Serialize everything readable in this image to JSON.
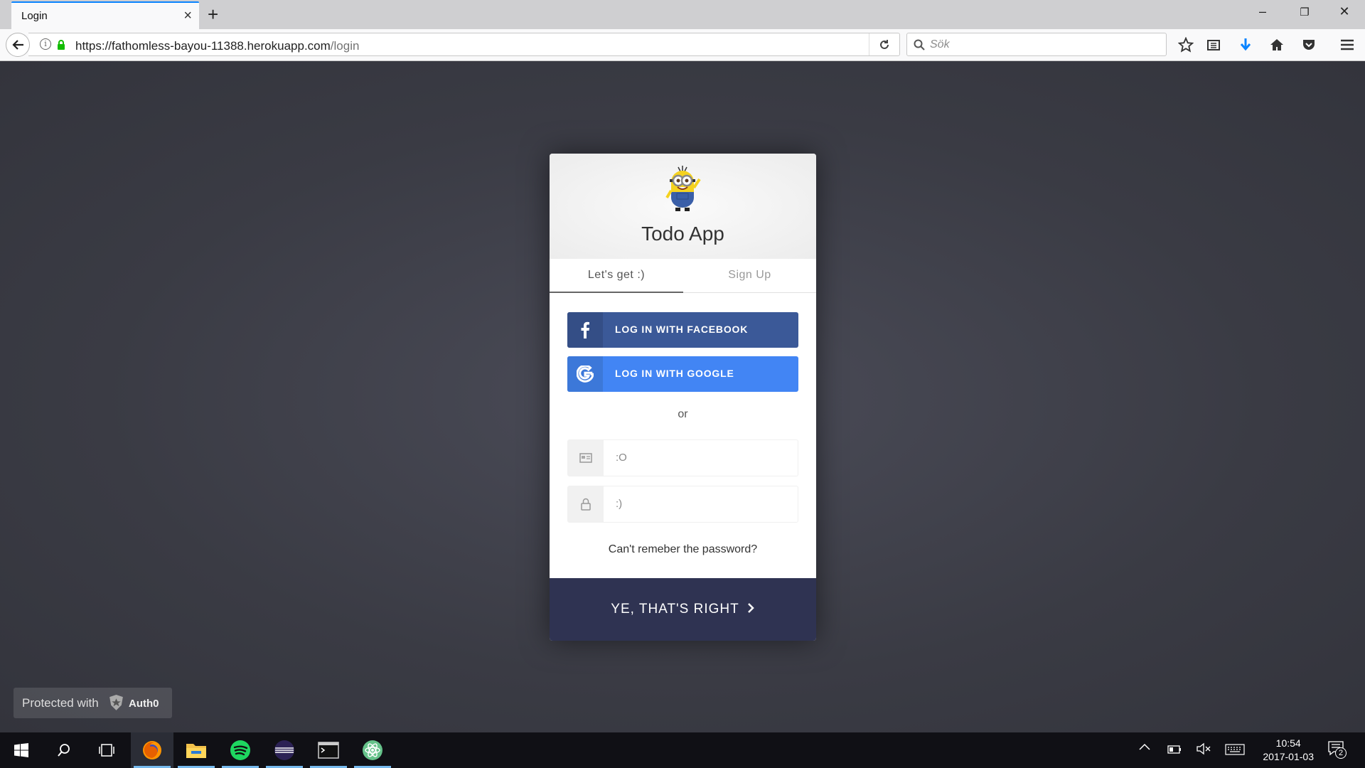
{
  "browser": {
    "tab_title": "Login",
    "url_host": "https://fathomless-bayou-11388.herokuapp.com",
    "url_path": "/login",
    "search_placeholder": "Sök"
  },
  "login": {
    "app_name": "Todo App",
    "tabs": [
      {
        "label": "Let's get :)"
      },
      {
        "label": "Sign Up"
      }
    ],
    "facebook_label": "LOG IN WITH FACEBOOK",
    "google_label": "LOG IN WITH GOOGLE",
    "or": "or",
    "email_placeholder": ":O",
    "password_placeholder": ":)",
    "forgot": "Can't remeber the password?",
    "submit_label": "YE, THAT'S RIGHT"
  },
  "badge": {
    "text": "Protected with",
    "brand": "Auth0"
  },
  "taskbar": {
    "time": "10:54",
    "date": "2017-01-03",
    "notifications": "2"
  },
  "colors": {
    "facebook": "#3b5998",
    "google": "#4285f4",
    "submit": "#2f3352"
  }
}
